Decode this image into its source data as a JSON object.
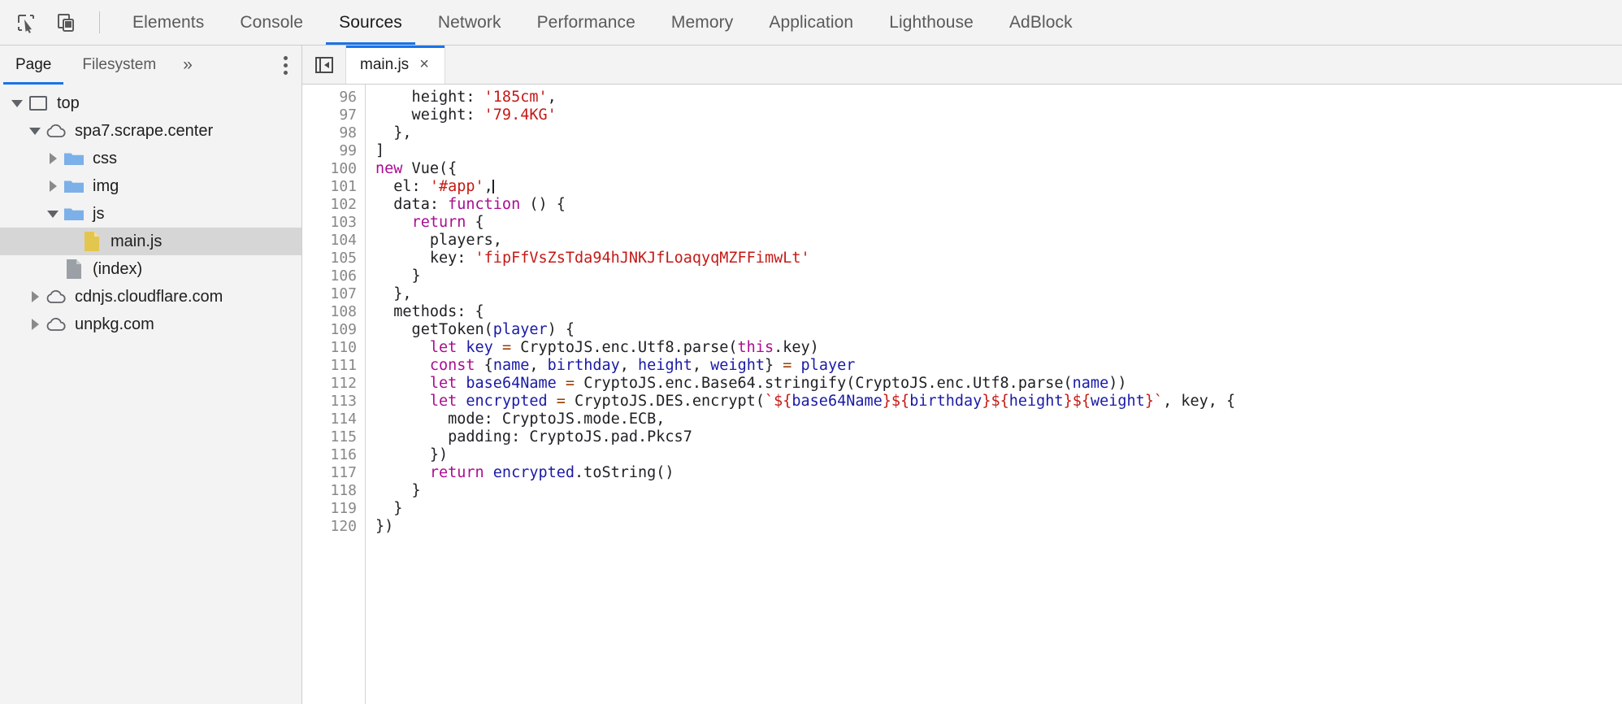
{
  "toolbar": {
    "icons": [
      {
        "name": "inspect-element-icon",
        "label": "Inspect element"
      },
      {
        "name": "device-toolbar-icon",
        "label": "Toggle device toolbar"
      }
    ],
    "tabs": [
      {
        "label": "Elements",
        "active": false
      },
      {
        "label": "Console",
        "active": false
      },
      {
        "label": "Sources",
        "active": true
      },
      {
        "label": "Network",
        "active": false
      },
      {
        "label": "Performance",
        "active": false
      },
      {
        "label": "Memory",
        "active": false
      },
      {
        "label": "Application",
        "active": false
      },
      {
        "label": "Lighthouse",
        "active": false
      },
      {
        "label": "AdBlock",
        "active": false
      }
    ]
  },
  "navigator": {
    "tabs": [
      {
        "label": "Page",
        "active": true
      },
      {
        "label": "Filesystem",
        "active": false
      }
    ],
    "more_label": "»",
    "menu_label": "More options",
    "tree": [
      {
        "label": "top",
        "indent": 0,
        "icon": "frame-icon",
        "twisty": "down",
        "selected": false
      },
      {
        "label": "spa7.scrape.center",
        "indent": 1,
        "icon": "cloud-icon",
        "twisty": "down",
        "selected": false
      },
      {
        "label": "css",
        "indent": 2,
        "icon": "folder-icon",
        "twisty": "right",
        "selected": false
      },
      {
        "label": "img",
        "indent": 2,
        "icon": "folder-icon",
        "twisty": "right",
        "selected": false
      },
      {
        "label": "js",
        "indent": 2,
        "icon": "folder-icon",
        "twisty": "down",
        "selected": false
      },
      {
        "label": "main.js",
        "indent": 3,
        "icon": "js-file-icon",
        "twisty": "none",
        "selected": true
      },
      {
        "label": "(index)",
        "indent": 2,
        "icon": "doc-file-icon",
        "twisty": "none",
        "selected": false
      },
      {
        "label": "cdnjs.cloudflare.com",
        "indent": 1,
        "icon": "cloud-icon",
        "twisty": "right",
        "selected": false
      },
      {
        "label": "unpkg.com",
        "indent": 1,
        "icon": "cloud-icon",
        "twisty": "right",
        "selected": false
      }
    ]
  },
  "editor": {
    "panel_toggle_name": "show-navigator-icon",
    "open_tab": {
      "label": "main.js",
      "close_label": "×"
    },
    "first_line_number": 96,
    "lines": [
      {
        "n": 96,
        "tokens": [
          {
            "t": "    height: ",
            "c": "plain"
          },
          {
            "t": "'185cm'",
            "c": "str"
          },
          {
            "t": ",",
            "c": "plain"
          }
        ]
      },
      {
        "n": 97,
        "tokens": [
          {
            "t": "    weight: ",
            "c": "plain"
          },
          {
            "t": "'79.4KG'",
            "c": "str"
          }
        ]
      },
      {
        "n": 98,
        "tokens": [
          {
            "t": "  },",
            "c": "plain"
          }
        ]
      },
      {
        "n": 99,
        "tokens": [
          {
            "t": "]",
            "c": "plain"
          }
        ]
      },
      {
        "n": 100,
        "tokens": [
          {
            "t": "new",
            "c": "kw"
          },
          {
            "t": " Vue({",
            "c": "plain"
          }
        ]
      },
      {
        "n": 101,
        "tokens": [
          {
            "t": "  el: ",
            "c": "plain"
          },
          {
            "t": "'#app'",
            "c": "str"
          },
          {
            "t": ",",
            "c": "plain"
          },
          {
            "t": "CARET",
            "c": "caret"
          }
        ]
      },
      {
        "n": 102,
        "tokens": [
          {
            "t": "  data: ",
            "c": "plain"
          },
          {
            "t": "function",
            "c": "kw"
          },
          {
            "t": " () {",
            "c": "plain"
          }
        ]
      },
      {
        "n": 103,
        "tokens": [
          {
            "t": "    ",
            "c": "plain"
          },
          {
            "t": "return",
            "c": "kw"
          },
          {
            "t": " {",
            "c": "plain"
          }
        ]
      },
      {
        "n": 104,
        "tokens": [
          {
            "t": "      players,",
            "c": "plain"
          }
        ]
      },
      {
        "n": 105,
        "tokens": [
          {
            "t": "      key: ",
            "c": "plain"
          },
          {
            "t": "'fipFfVsZsTda94hJNKJfLoaqyqMZFFimwLt'",
            "c": "str"
          }
        ]
      },
      {
        "n": 106,
        "tokens": [
          {
            "t": "    }",
            "c": "plain"
          }
        ]
      },
      {
        "n": 107,
        "tokens": [
          {
            "t": "  },",
            "c": "plain"
          }
        ]
      },
      {
        "n": 108,
        "tokens": [
          {
            "t": "  methods: {",
            "c": "plain"
          }
        ]
      },
      {
        "n": 109,
        "tokens": [
          {
            "t": "    getToken(",
            "c": "plain"
          },
          {
            "t": "player",
            "c": "var"
          },
          {
            "t": ") {",
            "c": "plain"
          }
        ]
      },
      {
        "n": 110,
        "tokens": [
          {
            "t": "      ",
            "c": "plain"
          },
          {
            "t": "let",
            "c": "kw"
          },
          {
            "t": " ",
            "c": "plain"
          },
          {
            "t": "key",
            "c": "var"
          },
          {
            "t": " ",
            "c": "plain"
          },
          {
            "t": "=",
            "c": "op"
          },
          {
            "t": " CryptoJS.enc.Utf8.parse(",
            "c": "plain"
          },
          {
            "t": "this",
            "c": "kw"
          },
          {
            "t": ".key)",
            "c": "plain"
          }
        ]
      },
      {
        "n": 111,
        "tokens": [
          {
            "t": "      ",
            "c": "plain"
          },
          {
            "t": "const",
            "c": "kw"
          },
          {
            "t": " {",
            "c": "plain"
          },
          {
            "t": "name",
            "c": "var"
          },
          {
            "t": ", ",
            "c": "plain"
          },
          {
            "t": "birthday",
            "c": "var"
          },
          {
            "t": ", ",
            "c": "plain"
          },
          {
            "t": "height",
            "c": "var"
          },
          {
            "t": ", ",
            "c": "plain"
          },
          {
            "t": "weight",
            "c": "var"
          },
          {
            "t": "} ",
            "c": "plain"
          },
          {
            "t": "=",
            "c": "op"
          },
          {
            "t": " ",
            "c": "plain"
          },
          {
            "t": "player",
            "c": "var"
          }
        ]
      },
      {
        "n": 112,
        "tokens": [
          {
            "t": "      ",
            "c": "plain"
          },
          {
            "t": "let",
            "c": "kw"
          },
          {
            "t": " ",
            "c": "plain"
          },
          {
            "t": "base64Name",
            "c": "var"
          },
          {
            "t": " ",
            "c": "plain"
          },
          {
            "t": "=",
            "c": "op"
          },
          {
            "t": " CryptoJS.enc.Base64.stringify(CryptoJS.enc.Utf8.parse(",
            "c": "plain"
          },
          {
            "t": "name",
            "c": "var"
          },
          {
            "t": "))",
            "c": "plain"
          }
        ]
      },
      {
        "n": 113,
        "tokens": [
          {
            "t": "      ",
            "c": "plain"
          },
          {
            "t": "let",
            "c": "kw"
          },
          {
            "t": " ",
            "c": "plain"
          },
          {
            "t": "encrypted",
            "c": "var"
          },
          {
            "t": " ",
            "c": "plain"
          },
          {
            "t": "=",
            "c": "op"
          },
          {
            "t": " CryptoJS.DES.encrypt(",
            "c": "plain"
          },
          {
            "t": "`",
            "c": "str"
          },
          {
            "t": "${",
            "c": "str"
          },
          {
            "t": "base64Name",
            "c": "var"
          },
          {
            "t": "}",
            "c": "str"
          },
          {
            "t": "${",
            "c": "str"
          },
          {
            "t": "birthday",
            "c": "var"
          },
          {
            "t": "}",
            "c": "str"
          },
          {
            "t": "${",
            "c": "str"
          },
          {
            "t": "height",
            "c": "var"
          },
          {
            "t": "}",
            "c": "str"
          },
          {
            "t": "${",
            "c": "str"
          },
          {
            "t": "weight",
            "c": "var"
          },
          {
            "t": "}",
            "c": "str"
          },
          {
            "t": "`",
            "c": "str"
          },
          {
            "t": ", key, {",
            "c": "plain"
          }
        ]
      },
      {
        "n": 114,
        "tokens": [
          {
            "t": "        mode: CryptoJS.mode.ECB,",
            "c": "plain"
          }
        ]
      },
      {
        "n": 115,
        "tokens": [
          {
            "t": "        padding: CryptoJS.pad.Pkcs7",
            "c": "plain"
          }
        ]
      },
      {
        "n": 116,
        "tokens": [
          {
            "t": "      })",
            "c": "plain"
          }
        ]
      },
      {
        "n": 117,
        "tokens": [
          {
            "t": "      ",
            "c": "plain"
          },
          {
            "t": "return",
            "c": "kw"
          },
          {
            "t": " ",
            "c": "plain"
          },
          {
            "t": "encrypted",
            "c": "var"
          },
          {
            "t": ".toString()",
            "c": "plain"
          }
        ]
      },
      {
        "n": 118,
        "tokens": [
          {
            "t": "    }",
            "c": "plain"
          }
        ]
      },
      {
        "n": 119,
        "tokens": [
          {
            "t": "  }",
            "c": "plain"
          }
        ]
      },
      {
        "n": 120,
        "tokens": [
          {
            "t": "})",
            "c": "plain"
          }
        ]
      }
    ]
  },
  "colors": {
    "accent": "#1a73e8",
    "chrome_bg": "#f3f3f3",
    "editor_bg": "#ffffff",
    "keyword": "#aa0d91",
    "string": "#c41a16",
    "variable": "#1a1aa6",
    "operator": "#9a3b00",
    "folder_blue": "#7cb0e8",
    "js_file_yellow": "#e2c64e",
    "selected_row": "#d6d6d6"
  }
}
